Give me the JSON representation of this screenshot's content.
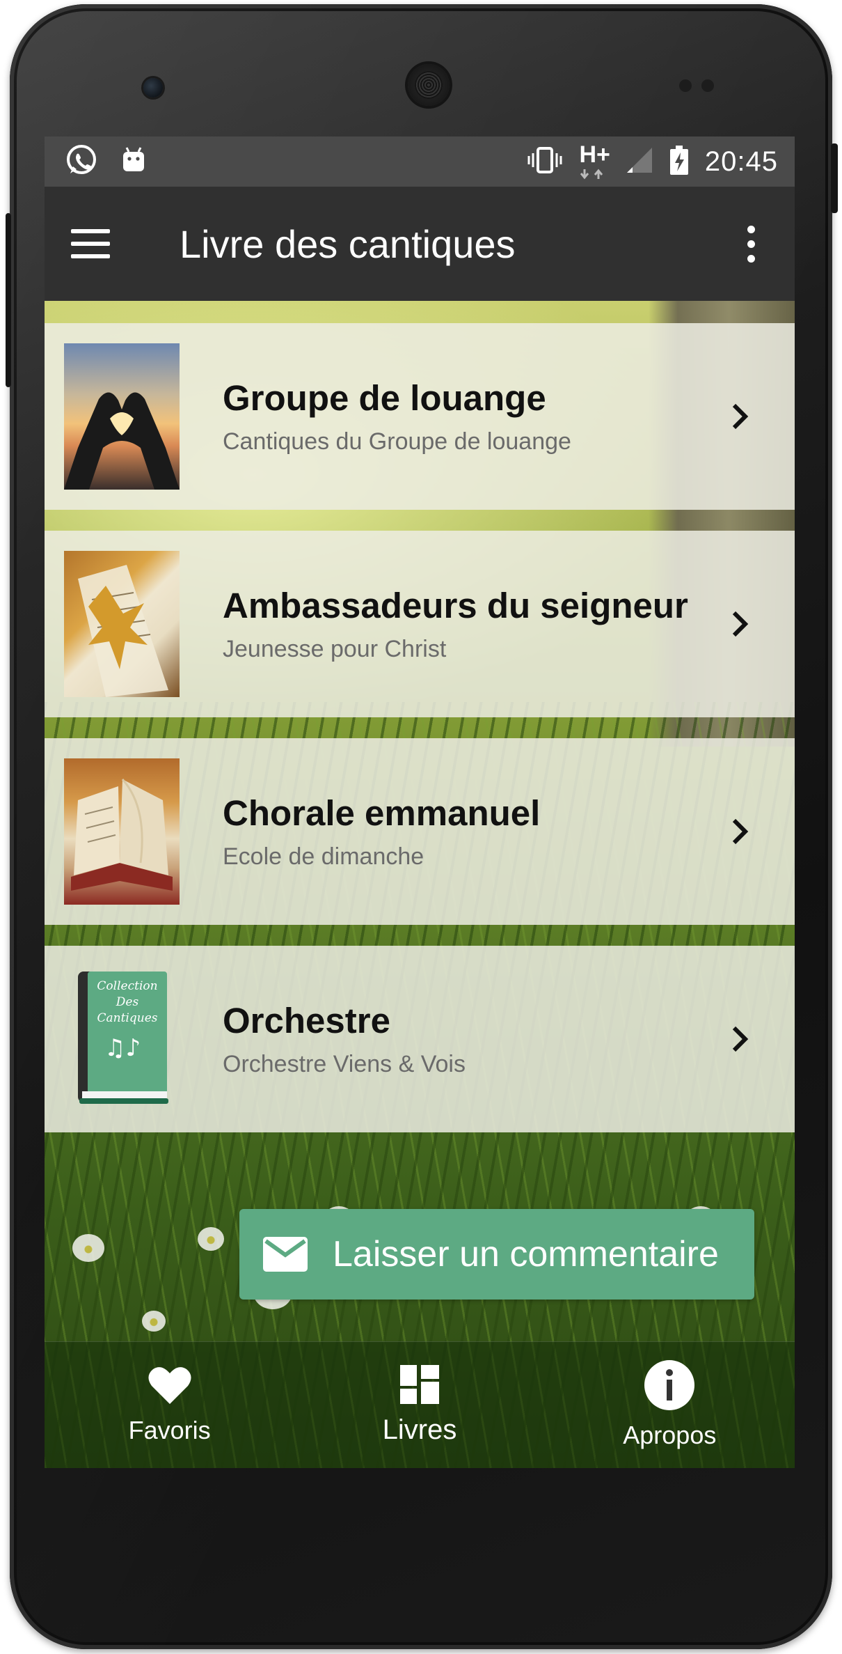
{
  "status_bar": {
    "network_label": "H+",
    "time": "20:45",
    "icons": [
      "whatsapp-icon",
      "android-icon",
      "vibrate-icon",
      "network-type-icon",
      "signal-icon",
      "battery-charging-icon"
    ]
  },
  "app_bar": {
    "title": "Livre des cantiques",
    "menu_icon": "hamburger-menu-icon",
    "overflow_icon": "more-vertical-icon"
  },
  "books": [
    {
      "title": "Groupe de louange",
      "subtitle": "Cantiques du Groupe de louange",
      "thumbnail": "heart-hands-sunset-image"
    },
    {
      "title": "Ambassadeurs du seigneur",
      "subtitle": "Jeunesse pour Christ",
      "thumbnail": "leaf-on-book-image"
    },
    {
      "title": "Chorale emmanuel",
      "subtitle": "Ecole de dimanche",
      "thumbnail": "open-book-autumn-image"
    },
    {
      "title": "Orchestre",
      "subtitle": "Orchestre Viens & Vois",
      "thumbnail": "collection-des-cantiques-book-image"
    }
  ],
  "collection_cover": {
    "line1": "Collection",
    "line2": "Des",
    "line3": "Cantiques"
  },
  "comment_button": {
    "label": "Laisser un commentaire",
    "icon": "mail-icon"
  },
  "bottom_nav": [
    {
      "label": "Favoris",
      "icon": "heart-icon"
    },
    {
      "label": "Livres",
      "icon": "dashboard-icon",
      "active": true
    },
    {
      "label": "Apropos",
      "icon": "info-icon"
    }
  ],
  "colors": {
    "accent": "#5daa83",
    "status_bar": "#4a4a4a",
    "app_bar": "#303030",
    "list_item_bg": "#ececE2"
  }
}
